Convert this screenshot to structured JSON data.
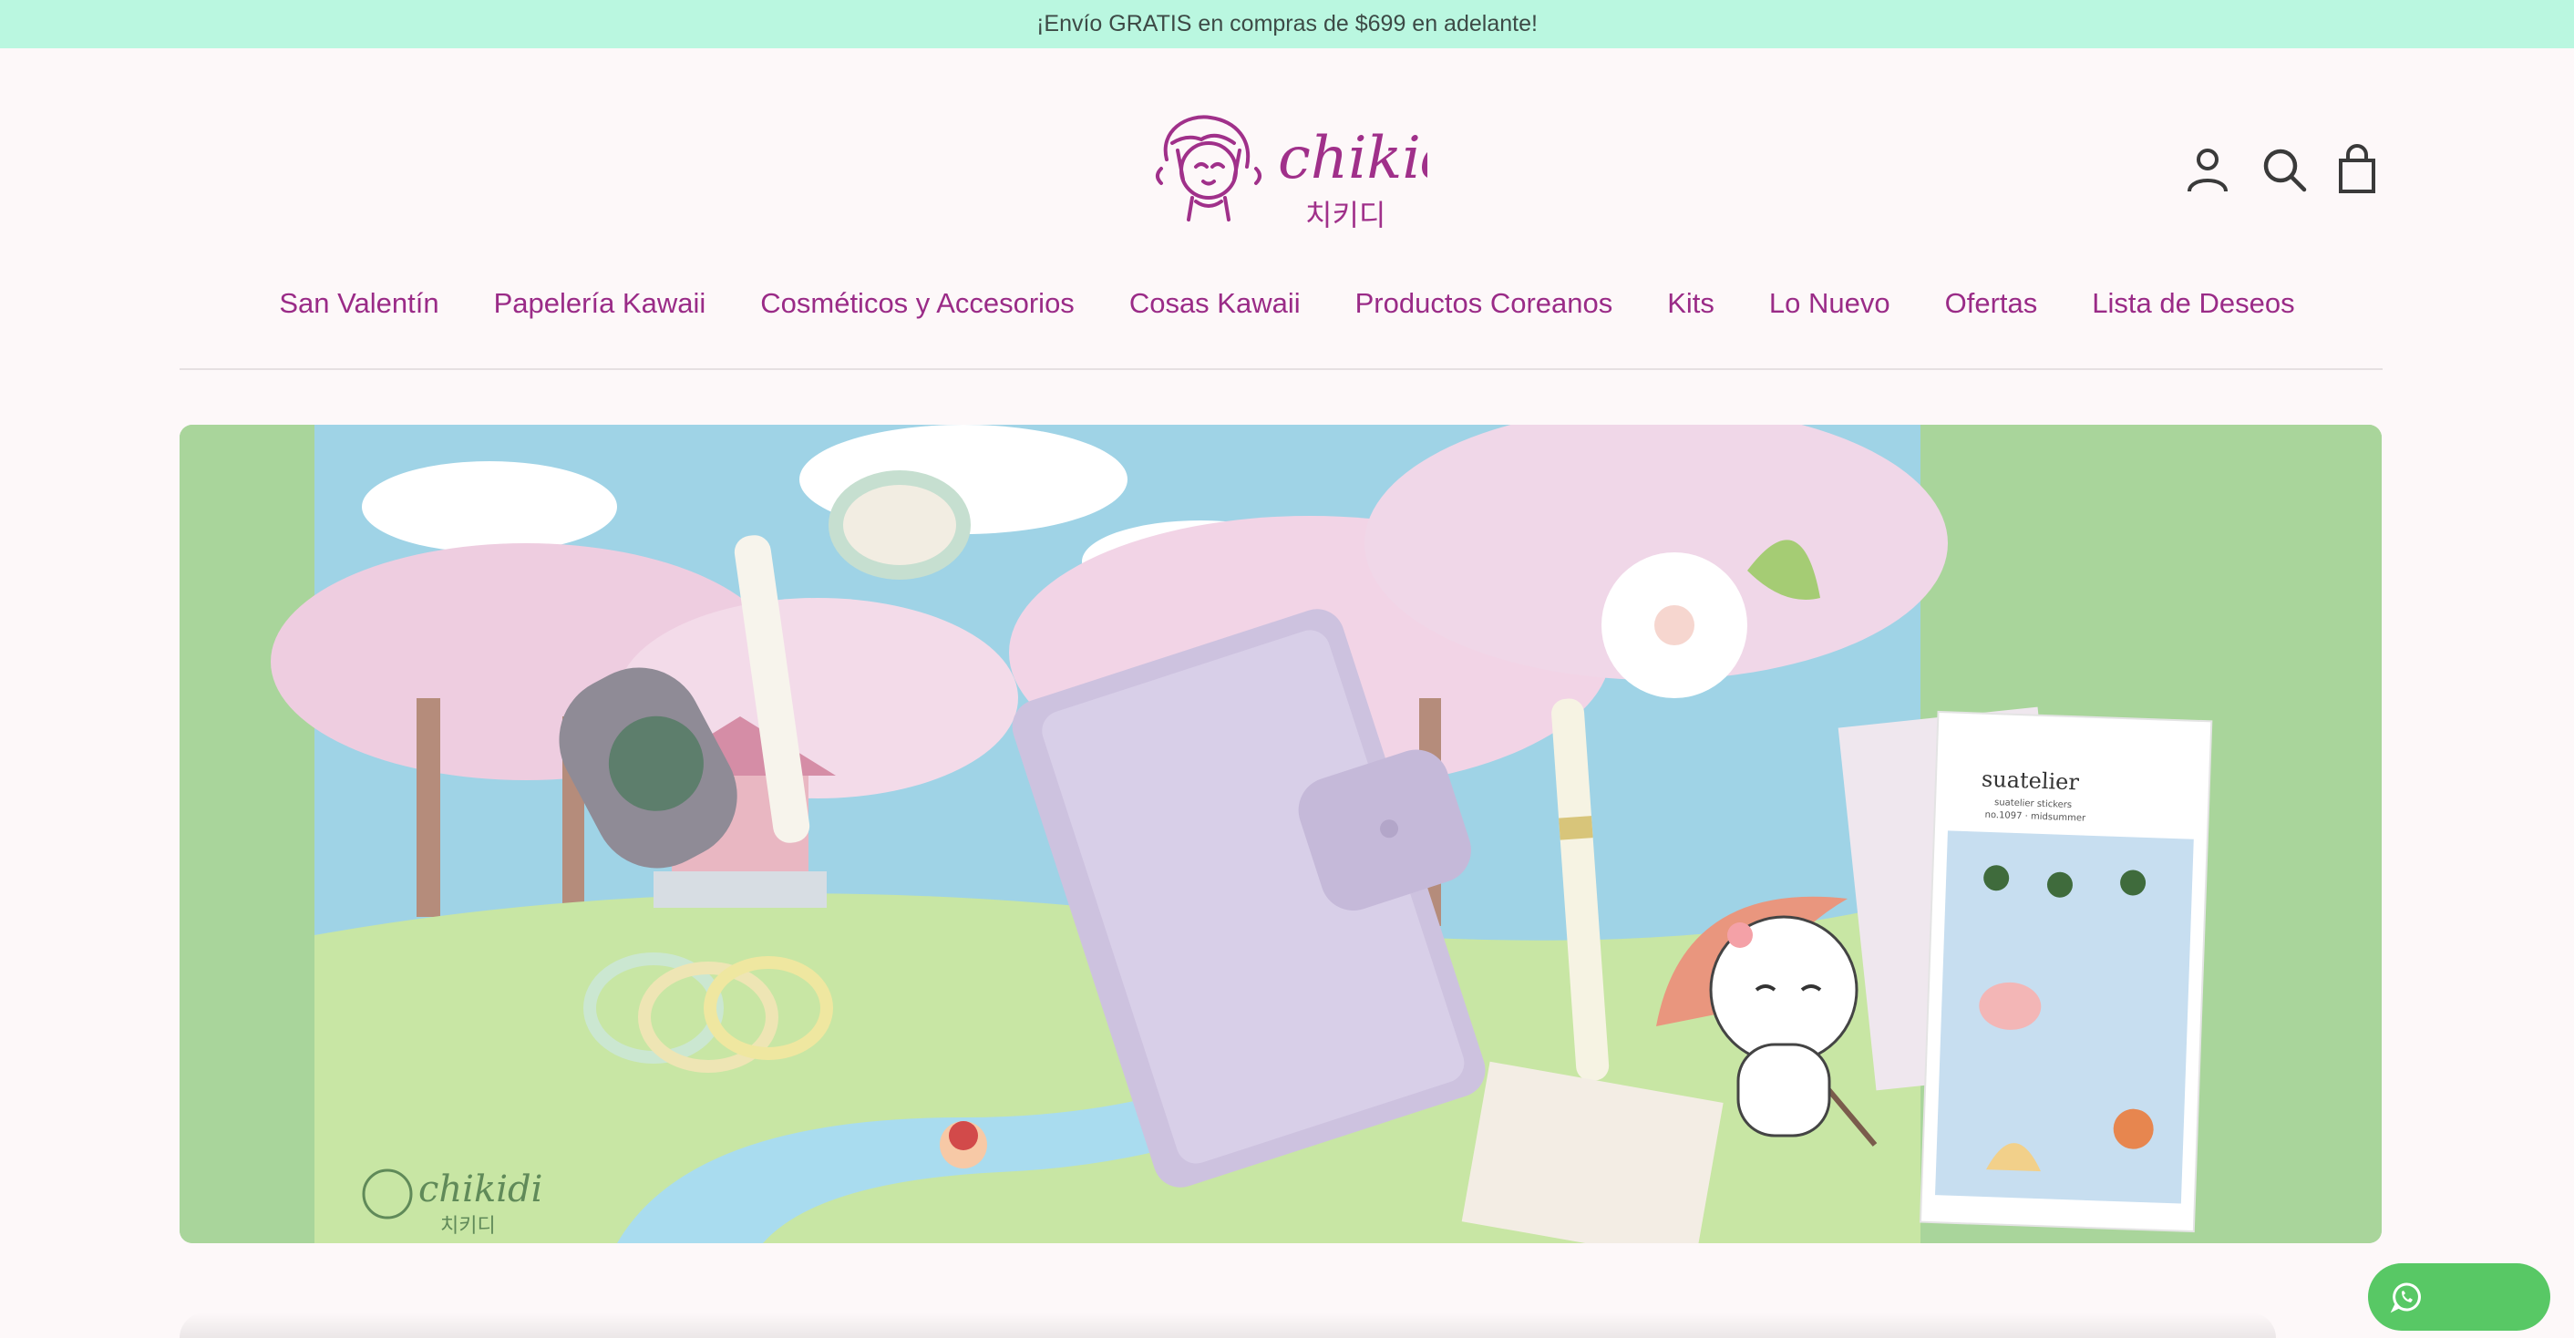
{
  "announcement": {
    "text": "¡Envío GRATIS en compras de $699 en adelante!"
  },
  "logo": {
    "name": "chikidi",
    "korean": "치키디"
  },
  "header_icons": [
    "account-icon",
    "search-icon",
    "cart-icon"
  ],
  "nav": {
    "items": [
      {
        "label": "San Valentín"
      },
      {
        "label": "Papelería Kawaii"
      },
      {
        "label": "Cosméticos y Accesorios"
      },
      {
        "label": "Cosas Kawaii"
      },
      {
        "label": "Productos Coreanos"
      },
      {
        "label": "Kits"
      },
      {
        "label": "Lo Nuevo"
      },
      {
        "label": "Ofertas"
      },
      {
        "label": "Lista de Deseos"
      }
    ]
  },
  "hero": {
    "watermark": "chikidi",
    "watermark_korean": "치키디",
    "sticker_brand": "suatelier",
    "sticker_caption": "suatelier stickers",
    "sticker_code": "no.1097 · midsummer"
  },
  "whatsapp": {
    "icon": "whatsapp-icon"
  },
  "colors": {
    "announcement_bg": "#baf7e0",
    "brand": "#9a2b87",
    "page_bg": "#fdf8f9",
    "whatsapp": "#58c865"
  }
}
